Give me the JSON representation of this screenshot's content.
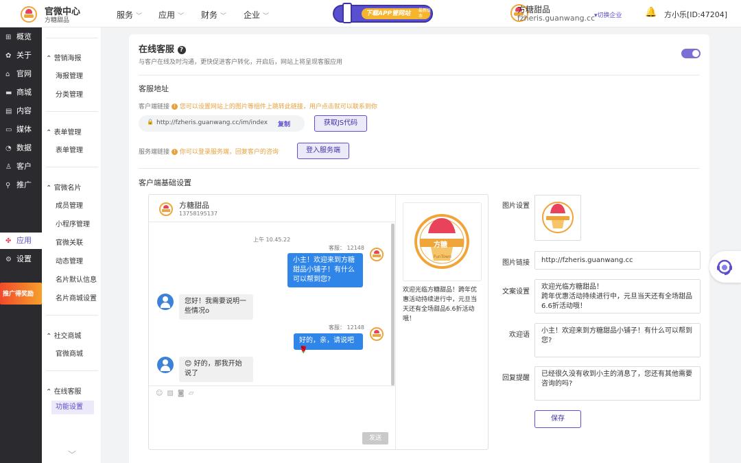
{
  "topbar": {
    "app_title": "官微中心",
    "app_subtitle": "方糖甜品",
    "nav": [
      "服务",
      "应用",
      "财务",
      "企业"
    ],
    "download_banner": "下载APP管网站",
    "download_badge": "最新版本",
    "company_name": "方糖甜品",
    "company_domain": "fzheris.guanwang.cc",
    "switch_label": "▾切换企业",
    "user": "方小乐[ID:47204]"
  },
  "leftbar": {
    "items": [
      {
        "icon": "grid-icon",
        "glyph": "⊞",
        "label": "概览"
      },
      {
        "icon": "gear-icon",
        "glyph": "✿",
        "label": "关于"
      },
      {
        "icon": "home-icon",
        "glyph": "⌂",
        "label": "官网"
      },
      {
        "icon": "shop-icon",
        "glyph": "▬",
        "label": "商城"
      },
      {
        "icon": "doc-icon",
        "glyph": "▤",
        "label": "内容"
      },
      {
        "icon": "media-icon",
        "glyph": "▭",
        "label": "媒体"
      },
      {
        "icon": "chart-icon",
        "glyph": "◔",
        "label": "数据"
      },
      {
        "icon": "user-icon",
        "glyph": "♙",
        "label": "客户"
      },
      {
        "icon": "link-icon",
        "glyph": "⚲",
        "label": "推广"
      },
      {
        "icon": "apps-icon",
        "glyph": "✤",
        "label": "应用"
      },
      {
        "icon": "settings-icon",
        "glyph": "⚙",
        "label": "设置"
      }
    ],
    "promo": "推广得奖励"
  },
  "subnav": {
    "groups": [
      {
        "title": "营销海报",
        "items": [
          "海报管理",
          "分类管理"
        ]
      },
      {
        "title": "表单管理",
        "items": [
          "表单管理"
        ]
      },
      {
        "title": "官微名片",
        "items": [
          "成员管理",
          "小程序管理",
          "官微关联",
          "动态管理",
          "名片默认信息",
          "名片商城设置"
        ]
      },
      {
        "title": "社交商城",
        "items": [
          "官微商城"
        ]
      },
      {
        "title": "在线客服",
        "items": [
          "功能设置"
        ]
      }
    ]
  },
  "main": {
    "title": "在线客服",
    "description": "与客户在线及时沟通，更快促进客户转化，开启后，网站上将呈现客服应用",
    "address_title": "客服地址",
    "client_link_label": "客户端链接",
    "client_link_tip": "您可以设置网站上的图片等组件上跳转此链接，用户点击就可以联系到你",
    "client_url": "http://fzheris.guanwang.cc/im/index",
    "copy_label": "复制",
    "get_js_label": "获取JS代码",
    "server_link_label": "服务端链接",
    "server_link_tip": "你可以登录服务端，回复客户的咨询",
    "login_server_label": "登入服务端",
    "basic_settings_title": "客户端基础设置"
  },
  "chat": {
    "header_name": "方糖甜品",
    "header_phone": "13758195137",
    "time": "上午 10.45.22",
    "agent_label_1": "客服： 12148",
    "msg_agent_1": "小主！欢迎来到方糖甜品小铺子！有什么可以帮到您?",
    "msg_user_1": "您好！我需要说明一些情况o",
    "agent_label_2": "客服： 12148",
    "msg_agent_2": "好的，亲，请说吧🌹",
    "msg_user_2": "😊 好的，那我开始说了",
    "send_label": "发送",
    "preview_text": "欢迎光临方糖甜品！跨年优惠活动持续进行中，元旦当天还有全场甜品6.6折活动哦！",
    "brand_badge": "方糖",
    "brand_sub": "FunTown"
  },
  "settings": {
    "image_label": "图片设置",
    "image_link_label": "图片链接",
    "image_link_value": "http://fzheris.guanwang.cc",
    "copy_label": "文案设置",
    "copy_value": "欢迎光临方糖甜品！\n跨年优惠活动持续进行中，元旦当天还有全场甜品6.6折活动哦！",
    "welcome_label": "欢迎语",
    "welcome_value": "小主！欢迎来到方糖甜品小铺子！有什么可以帮到您?",
    "reply_label": "回复提醒",
    "reply_value": "已经很久没有收到小主的消息了，您还有其他需要咨询的吗?",
    "save_label": "保存"
  },
  "colors": {
    "accent": "#5a4fcf",
    "warning": "#e6a23c",
    "bubble": "#2f86e8",
    "sidebar": "#2b2b2f"
  }
}
